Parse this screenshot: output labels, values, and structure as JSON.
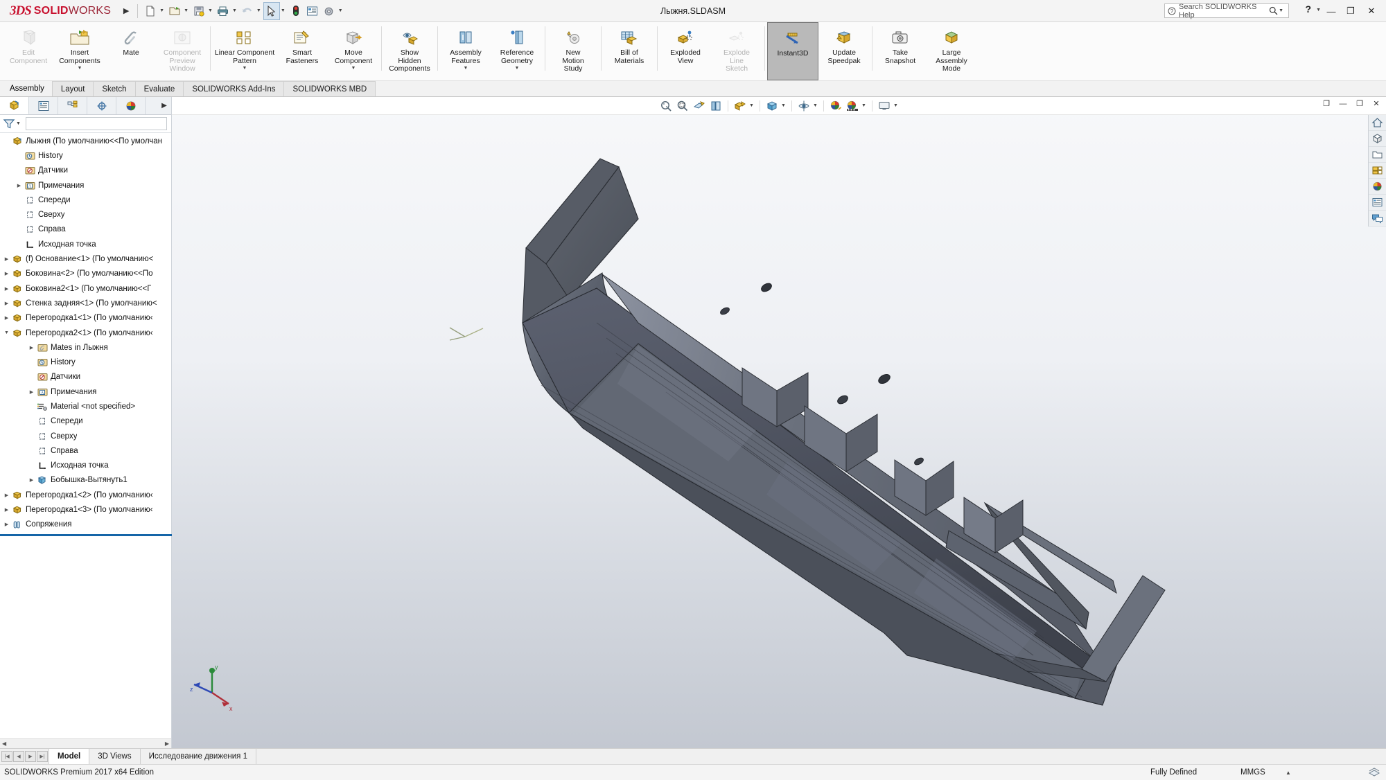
{
  "titlebar": {
    "brand_ds": "3DS",
    "brand_solid": "SOLID",
    "brand_works": "WORKS",
    "document_title": "Лыжня.SLDASM",
    "search_placeholder": "Search SOLIDWORKS Help",
    "help_label": "?",
    "minimize_label": "—",
    "restore_label": "❐",
    "close_label": "✕",
    "quick_access": [
      {
        "name": "new-document",
        "icon": "new-file-icon",
        "has_caret": true,
        "active": false
      },
      {
        "name": "open-document",
        "icon": "open-folder-icon",
        "has_caret": true,
        "active": false
      },
      {
        "name": "save-document",
        "icon": "save-icon",
        "has_caret": true,
        "active": false
      },
      {
        "name": "print-document",
        "icon": "printer-icon",
        "has_caret": true,
        "active": false
      },
      {
        "name": "undo",
        "icon": "undo-arrow-icon",
        "has_caret": true,
        "active": false
      },
      {
        "name": "select",
        "icon": "cursor-arrow-icon",
        "has_caret": true,
        "active": true
      },
      {
        "name": "rebuild",
        "icon": "traffic-light-icon",
        "has_caret": false,
        "active": false
      },
      {
        "name": "file-properties",
        "icon": "properties-list-icon",
        "has_caret": false,
        "active": false
      },
      {
        "name": "options",
        "icon": "gear-icon",
        "has_caret": true,
        "active": false
      }
    ]
  },
  "ribbon": {
    "commands": [
      {
        "label": "Edit\nComponent",
        "icon": "edit-component-icon",
        "disabled": true,
        "caret": false,
        "active": false,
        "wide": false
      },
      {
        "label": "Insert\nComponents",
        "icon": "insert-components-icon",
        "disabled": false,
        "caret": true,
        "active": false,
        "wide": false
      },
      {
        "label": "Mate",
        "icon": "mate-paperclip-icon",
        "disabled": false,
        "caret": false,
        "active": false,
        "wide": false
      },
      {
        "label": "Component\nPreview\nWindow",
        "icon": "component-preview-icon",
        "disabled": true,
        "caret": false,
        "active": false,
        "wide": false
      },
      {
        "label": "Linear Component\nPattern",
        "icon": "linear-pattern-icon",
        "disabled": false,
        "caret": true,
        "active": false,
        "wide": true
      },
      {
        "label": "Smart\nFasteners",
        "icon": "smart-fasteners-icon",
        "disabled": false,
        "caret": false,
        "active": false,
        "wide": false
      },
      {
        "label": "Move\nComponent",
        "icon": "move-component-icon",
        "disabled": false,
        "caret": true,
        "active": false,
        "wide": false
      },
      {
        "label": "Show\nHidden\nComponents",
        "icon": "show-hidden-icon",
        "disabled": false,
        "caret": false,
        "active": false,
        "wide": false
      },
      {
        "label": "Assembly\nFeatures",
        "icon": "assembly-features-icon",
        "disabled": false,
        "caret": true,
        "active": false,
        "wide": false
      },
      {
        "label": "Reference\nGeometry",
        "icon": "reference-geometry-icon",
        "disabled": false,
        "caret": true,
        "active": false,
        "wide": false
      },
      {
        "label": "New\nMotion\nStudy",
        "icon": "new-motion-study-icon",
        "disabled": false,
        "caret": false,
        "active": false,
        "wide": false
      },
      {
        "label": "Bill of\nMaterials",
        "icon": "bill-of-materials-icon",
        "disabled": false,
        "caret": false,
        "active": false,
        "wide": false
      },
      {
        "label": "Exploded\nView",
        "icon": "exploded-view-icon",
        "disabled": false,
        "caret": false,
        "active": false,
        "wide": false
      },
      {
        "label": "Explode\nLine\nSketch",
        "icon": "explode-line-sketch-icon",
        "disabled": true,
        "caret": false,
        "active": false,
        "wide": false
      },
      {
        "label": "Instant3D",
        "icon": "instant3d-icon",
        "disabled": false,
        "caret": false,
        "active": true,
        "wide": false
      },
      {
        "label": "Update\nSpeedpak",
        "icon": "update-speedpak-icon",
        "disabled": false,
        "caret": false,
        "active": false,
        "wide": false
      },
      {
        "label": "Take\nSnapshot",
        "icon": "camera-icon",
        "disabled": false,
        "caret": false,
        "active": false,
        "wide": false
      },
      {
        "label": "Large\nAssembly\nMode",
        "icon": "large-assembly-icon",
        "disabled": false,
        "caret": false,
        "active": false,
        "wide": false
      }
    ]
  },
  "tabs": [
    {
      "label": "Assembly",
      "selected": true
    },
    {
      "label": "Layout",
      "selected": false
    },
    {
      "label": "Sketch",
      "selected": false
    },
    {
      "label": "Evaluate",
      "selected": false
    },
    {
      "label": "SOLIDWORKS Add-Ins",
      "selected": false
    },
    {
      "label": "SOLIDWORKS MBD",
      "selected": false
    }
  ],
  "manager_tabs": [
    {
      "name": "feature-manager-tab",
      "icon": "assembly-cube-icon",
      "selected": true
    },
    {
      "name": "property-manager-tab",
      "icon": "property-list-icon",
      "selected": false
    },
    {
      "name": "configuration-manager-tab",
      "icon": "configuration-icon",
      "selected": false
    },
    {
      "name": "dimxpert-manager-tab",
      "icon": "dimxpert-target-icon",
      "selected": false
    },
    {
      "name": "display-manager-tab",
      "icon": "display-sphere-icon",
      "selected": false
    }
  ],
  "filter": {
    "icon": "filter-funnel-icon",
    "value": "",
    "placeholder": ""
  },
  "tree": [
    {
      "label": "Лыжня  (По умолчанию<<По умолчан",
      "icon": "assembly-icon",
      "indent": 0,
      "twisty": "none"
    },
    {
      "label": "History",
      "icon": "history-icon",
      "indent": 1,
      "twisty": "none"
    },
    {
      "label": "Датчики",
      "icon": "sensors-icon",
      "indent": 1,
      "twisty": "none"
    },
    {
      "label": "Примечания",
      "icon": "annotations-icon",
      "indent": 1,
      "twisty": "collapsed"
    },
    {
      "label": "Спереди",
      "icon": "plane-icon",
      "indent": 1,
      "twisty": "none"
    },
    {
      "label": "Сверху",
      "icon": "plane-icon",
      "indent": 1,
      "twisty": "none"
    },
    {
      "label": "Справа",
      "icon": "plane-icon",
      "indent": 1,
      "twisty": "none"
    },
    {
      "label": "Исходная точка",
      "icon": "origin-icon",
      "indent": 1,
      "twisty": "none"
    },
    {
      "label": "(f) Основание<1> (По умолчанию<",
      "icon": "part-icon",
      "indent": 0,
      "twisty": "collapsed"
    },
    {
      "label": "Боковина<2> (По умолчанию<<По",
      "icon": "part-icon",
      "indent": 0,
      "twisty": "collapsed"
    },
    {
      "label": "Боковина2<1> (По умолчанию<<Г",
      "icon": "part-icon",
      "indent": 0,
      "twisty": "collapsed"
    },
    {
      "label": "Стенка задняя<1> (По умолчанию<",
      "icon": "part-icon",
      "indent": 0,
      "twisty": "collapsed"
    },
    {
      "label": "Перегородка1<1> (По умолчанию‹",
      "icon": "part-icon",
      "indent": 0,
      "twisty": "collapsed"
    },
    {
      "label": "Перегородка2<1> (По умолчанию‹",
      "icon": "part-icon",
      "indent": 0,
      "twisty": "expanded"
    },
    {
      "label": "Mates in Лыжня",
      "icon": "mates-folder-icon",
      "indent": 2,
      "twisty": "collapsed"
    },
    {
      "label": "History",
      "icon": "history-icon",
      "indent": 2,
      "twisty": "none"
    },
    {
      "label": "Датчики",
      "icon": "sensors-icon",
      "indent": 2,
      "twisty": "none"
    },
    {
      "label": "Примечания",
      "icon": "annotations-icon",
      "indent": 2,
      "twisty": "collapsed"
    },
    {
      "label": "Material <not specified>",
      "icon": "material-icon",
      "indent": 2,
      "twisty": "none"
    },
    {
      "label": "Спереди",
      "icon": "plane-icon",
      "indent": 2,
      "twisty": "none"
    },
    {
      "label": "Сверху",
      "icon": "plane-icon",
      "indent": 2,
      "twisty": "none"
    },
    {
      "label": "Справа",
      "icon": "plane-icon",
      "indent": 2,
      "twisty": "none"
    },
    {
      "label": "Исходная точка",
      "icon": "origin-icon",
      "indent": 2,
      "twisty": "none"
    },
    {
      "label": "Бобышка-Вытянуть1",
      "icon": "extrude-boss-icon",
      "indent": 2,
      "twisty": "collapsed"
    },
    {
      "label": "Перегородка1<2> (По умолчанию‹",
      "icon": "part-icon",
      "indent": 0,
      "twisty": "collapsed"
    },
    {
      "label": "Перегородка1<3> (По умолчанию‹",
      "icon": "part-icon",
      "indent": 0,
      "twisty": "collapsed"
    },
    {
      "label": "Сопряжения",
      "icon": "mates-icon",
      "indent": 0,
      "twisty": "collapsed"
    }
  ],
  "viewport_toolbar": [
    {
      "name": "zoom-to-fit-button",
      "icon": "zoom-fit-icon",
      "caret": false
    },
    {
      "name": "zoom-to-area-button",
      "icon": "zoom-area-icon",
      "caret": false
    },
    {
      "name": "previous-view-button",
      "icon": "previous-view-icon",
      "caret": false
    },
    {
      "name": "section-view-button",
      "icon": "section-view-icon",
      "caret": false
    },
    {
      "name": "view-orientation-button",
      "icon": "view-orientation-icon",
      "caret": true
    },
    {
      "name": "display-style-button",
      "icon": "display-style-cube-icon",
      "caret": true
    },
    {
      "name": "hide-show-items-button",
      "icon": "hide-show-eye-icon",
      "caret": true
    },
    {
      "name": "edit-appearance-button",
      "icon": "appearance-sphere-icon",
      "caret": false
    },
    {
      "name": "apply-scene-button",
      "icon": "scene-icon",
      "caret": true
    },
    {
      "name": "view-settings-button",
      "icon": "monitor-icon",
      "caret": true
    }
  ],
  "viewport_window_buttons": [
    {
      "name": "restore-doc-window",
      "icon": "restore-doc-icon"
    },
    {
      "name": "minimize-doc-window",
      "icon": "minimize-doc-icon"
    },
    {
      "name": "maximize-doc-window",
      "icon": "maximize-doc-icon"
    },
    {
      "name": "close-doc-window",
      "icon": "close-doc-icon"
    }
  ],
  "right_rail": [
    {
      "name": "home-task-pane",
      "icon": "home-icon"
    },
    {
      "name": "design-library-pane",
      "icon": "design-library-icon"
    },
    {
      "name": "file-explorer-pane",
      "icon": "file-explorer-folder-icon"
    },
    {
      "name": "view-palette-pane",
      "icon": "view-palette-icon"
    },
    {
      "name": "appearances-scenes-pane",
      "icon": "appearances-sphere-icon"
    },
    {
      "name": "custom-properties-pane",
      "icon": "custom-properties-icon"
    },
    {
      "name": "solidworks-forum-pane",
      "icon": "forum-bubble-icon"
    }
  ],
  "triad": {
    "x_label": "x",
    "y_label": "y",
    "z_label": "z",
    "x_color": "#b0303a",
    "y_color": "#2a8a3a",
    "z_color": "#2e49b5"
  },
  "doc_tabs": [
    {
      "label": "Model",
      "selected": true
    },
    {
      "label": "3D Views",
      "selected": false
    },
    {
      "label": "Исследование движения 1",
      "selected": false
    }
  ],
  "statusbar": {
    "edition": "SOLIDWORKS Premium 2017 x64 Edition",
    "state": "Fully Defined",
    "units": "MMGS",
    "units_caret": "▲",
    "overlay_icon": "overlay-icon"
  },
  "model": {
    "name": "Лыжня assembly — sheet-metal channel with partitions",
    "body_color": "#4e535e",
    "highlight_color": "#7d828e",
    "edge_color": "#23262c"
  }
}
